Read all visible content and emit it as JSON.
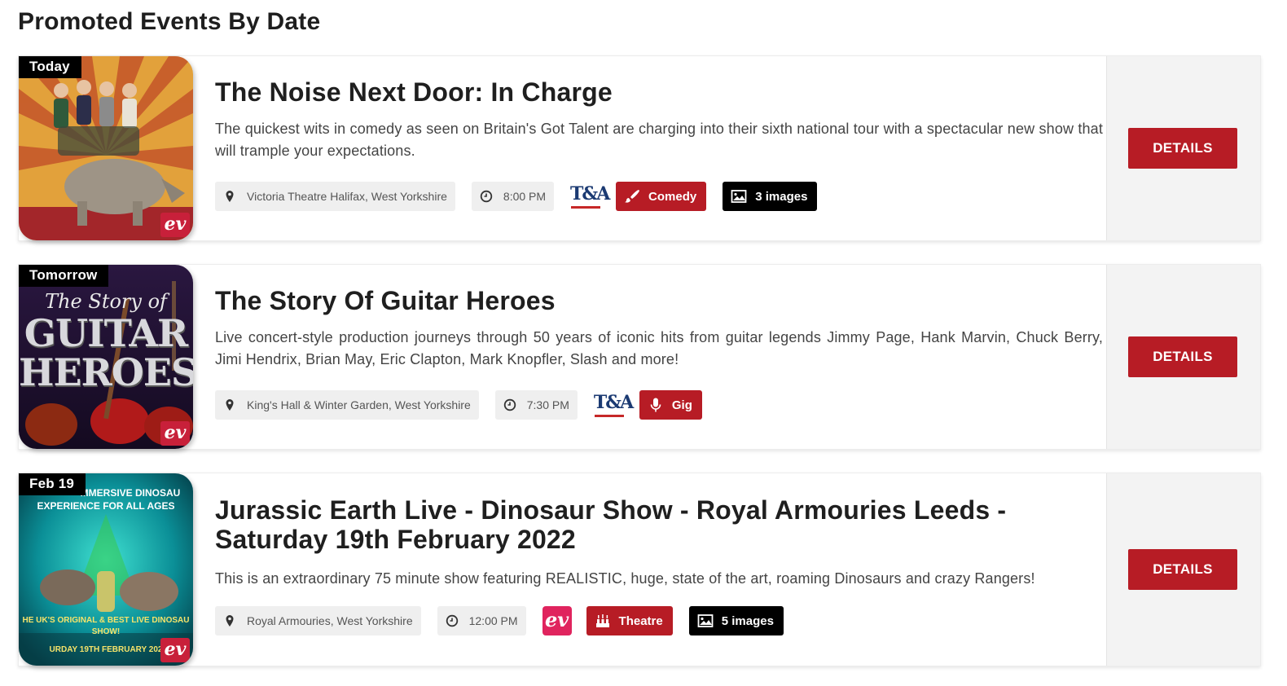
{
  "section_title": "Promoted Events By Date",
  "events": [
    {
      "date_badge": "Today",
      "title": "The Noise Next Door: In Charge",
      "description": "The quickest wits in comedy as seen on Britain's Got Talent are charging into their sixth national tour with a spectacular new show that will trample your expectations.",
      "venue": "Victoria Theatre Halifax, West Yorkshire",
      "time": "8:00 PM",
      "provider_logo": "T&A",
      "category": "Comedy",
      "category_icon": "paintbrush-icon",
      "images": "3 images",
      "button": "DETAILS",
      "thumb_logo": "ev"
    },
    {
      "date_badge": "Tomorrow",
      "title": "The Story Of Guitar Heroes",
      "description": "Live concert-style production journeys through 50 years of iconic hits from guitar legends Jimmy Page, Hank Marvin, Chuck Berry, Jimi Hendrix, Brian May, Eric Clapton, Mark Knopfler, Slash and more!",
      "venue": "King's Hall & Winter Garden, West Yorkshire",
      "time": "7:30 PM",
      "provider_logo": "T&A",
      "category": "Gig",
      "category_icon": "microphone-icon",
      "button": "DETAILS",
      "thumb_logo": "ev",
      "thumb_text": {
        "line1": "The Story of",
        "line2": "GUITAR",
        "line3": "HEROES"
      }
    },
    {
      "date_badge": "Feb 19",
      "title": "Jurassic Earth Live - Dinosaur Show - Royal Armouries Leeds - Saturday 19th February 2022",
      "description": "This is an extraordinary 75 minute show featuring REALISTIC, huge, state of the art, roaming Dinosaurs and crazy Rangers!",
      "venue": "Royal Armouries, West Yorkshire",
      "time": "12:00 PM",
      "provider_logo": "ev",
      "category": "Theatre",
      "category_icon": "theatre-icon",
      "images": "5 images",
      "button": "DETAILS",
      "thumb_logo": "ev",
      "thumb_text": {
        "top": "MMERSIVE DINOSAU",
        "top2": "EXPERIENCE FOR ALL AGES",
        "bottom": "HE UK'S ORIGINAL & BEST LIVE DINOSAU",
        "bottom2": "SHOW!",
        "bottom3": "URDAY 19TH FEBRUARY 202"
      }
    }
  ],
  "colors": {
    "accent_red": "#b71c25",
    "badge_black": "#000000",
    "chip_grey": "#efefef",
    "ev_pink": "#e0245e"
  }
}
